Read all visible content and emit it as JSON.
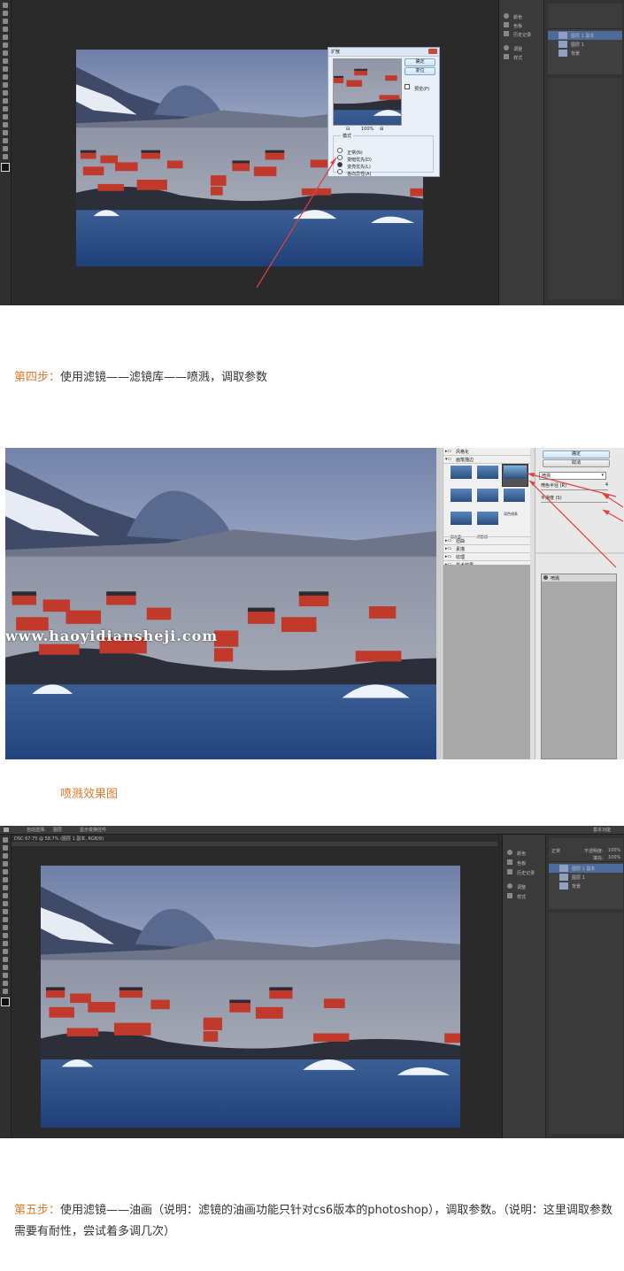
{
  "section1": {
    "dialog": {
      "title": "扩散",
      "ok_label": "确定",
      "reset_label": "复位",
      "preview_label": "预览(P)",
      "zoom_minus": "⊟",
      "zoom_value": "100%",
      "zoom_plus": "⊞",
      "mode_group": "模式",
      "modes": [
        "正常(N)",
        "变暗优先(D)",
        "变亮优先(L)",
        "各向异性(A)"
      ],
      "selected_mode_index": 2
    },
    "panels": {
      "adjust_items": [
        "调整",
        "样式"
      ],
      "side_items": [
        "颜色",
        "色板",
        "历史记录"
      ],
      "layers": [
        "图层 1 副本",
        "图层 1",
        "背景"
      ]
    }
  },
  "step4": {
    "label": "第四步：",
    "text": "使用滤镜——滤镜库——喷溅，调取参数"
  },
  "section2": {
    "watermark": "www.haoyidiansheji.com",
    "categories_top": [
      "风格化"
    ],
    "category_open": "画笔描边",
    "thumbs": [
      "成角的线条",
      "墨水轮廓",
      "喷溅",
      "喷色描边",
      "强化的边缘",
      "深色线条",
      "烟灰墨",
      "阴影线"
    ],
    "categories_bottom": [
      "扭曲",
      "素描",
      "纹理",
      "艺术效果"
    ],
    "ok_label": "确定",
    "cancel_label": "取消",
    "filter_select": "喷溅",
    "params": [
      {
        "label": "喷色半径 (R)",
        "value": "4"
      },
      {
        "label": "平滑度 (S)",
        "value": "1"
      }
    ],
    "layer_item": "喷溅"
  },
  "caption2": "喷溅效果图",
  "section3": {
    "menu_items": [
      "自动选择:",
      "图层",
      "显示变换控件"
    ],
    "tab_label": "DSC 67.75 @ 58.7% (图层 1 副本, RGB/8)",
    "workspace": "基本功能",
    "panels": {
      "adjust_items": [
        "调整",
        "样式"
      ],
      "side_items": [
        "颜色",
        "色板",
        "历史记录"
      ],
      "layers": [
        "图层 1 副本",
        "图层 1",
        "背景"
      ],
      "blend_mode": "正常",
      "opacity_label": "不透明度:",
      "opacity_value": "100%",
      "fill_label": "填充:",
      "fill_value": "100%"
    }
  },
  "step5": {
    "label": "第五步：",
    "text": "使用滤镜——油画（说明：滤镜的油画功能只针对cs6版本的photoshop），调取参数。（说明：这里调取参数需要有耐性，尝试着多调几次）"
  },
  "colors": {
    "accent": "#e07a2e",
    "ps_bg": "#2a2a2a",
    "ps_panel": "#3a3a3a",
    "sky": "#9aa6c4",
    "water": "#2d4f86",
    "house_red": "#c0392b",
    "arrow": "#e04040"
  }
}
